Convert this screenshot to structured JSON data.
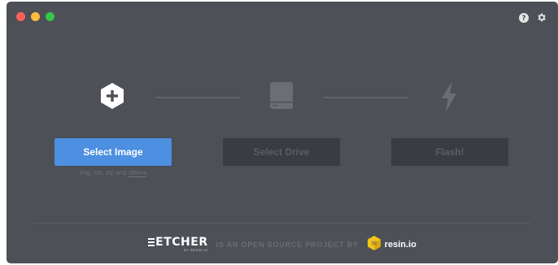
{
  "window": {
    "controls": [
      "close",
      "minimize",
      "maximize"
    ],
    "top_icons": [
      "help-icon",
      "settings-icon"
    ]
  },
  "steps": [
    {
      "icon": "plus-hexagon-icon",
      "button_label": "Select Image",
      "enabled": true
    },
    {
      "icon": "drive-icon",
      "button_label": "Select Drive",
      "enabled": false
    },
    {
      "icon": "flash-icon",
      "button_label": "Flash!",
      "enabled": false
    }
  ],
  "image_formats": {
    "text": "img, iso, zip and",
    "link": "others"
  },
  "footer": {
    "logo_word": "ETCHER",
    "logo_sub": "BY RESIN.IO",
    "tagline": "IS AN OPEN SOURCE PROJECT BY",
    "brand": "resin.io"
  },
  "colors": {
    "window_bg": "#4d5057",
    "primary": "#4d8fe0",
    "disabled_bg": "#3a3c41",
    "disabled_text": "#5b5e65",
    "inactive_icon": "#6b6e75",
    "resin_yellow": "#f2c41a"
  }
}
